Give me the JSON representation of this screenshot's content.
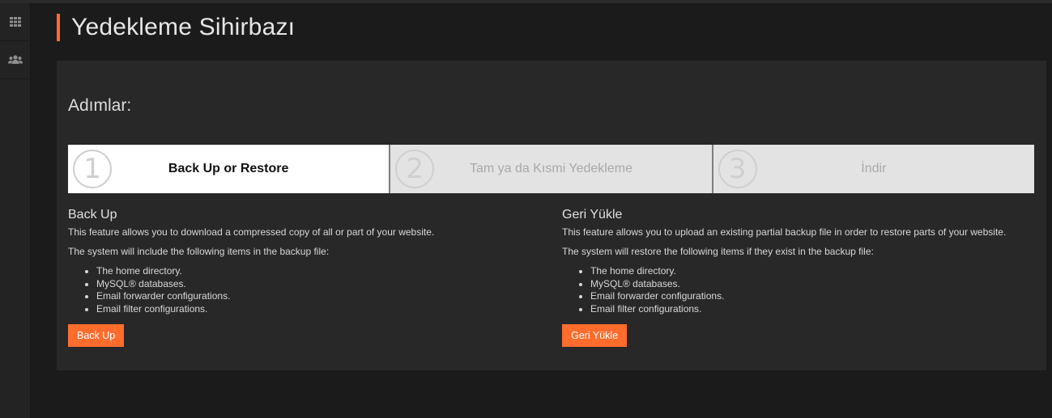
{
  "sidebar": {
    "items": [
      {
        "icon": "grid-icon"
      },
      {
        "icon": "users-icon"
      }
    ]
  },
  "page": {
    "title": "Yedekleme Sihirbazı",
    "accent_color": "#ff6c2c"
  },
  "wizard": {
    "heading": "Adımlar:",
    "steps": [
      {
        "number": "1",
        "label": "Back Up or Restore",
        "active": true
      },
      {
        "number": "2",
        "label": "Tam ya da Kısmi Yedekleme",
        "active": false
      },
      {
        "number": "3",
        "label": "İndir",
        "active": false
      }
    ]
  },
  "backup": {
    "title": "Back Up",
    "description": "This feature allows you to download a compressed copy of all or part of your website.",
    "intro": "The system will include the following items in the backup file:",
    "items": [
      "The home directory.",
      "MySQL® databases.",
      "Email forwarder configurations.",
      "Email filter configurations."
    ],
    "button_label": "Back Up"
  },
  "restore": {
    "title": "Geri Yükle",
    "description": "This feature allows you to upload an existing partial backup file in order to restore parts of your website.",
    "intro": "The system will restore the following items if they exist in the backup file:",
    "items": [
      "The home directory.",
      "MySQL® databases.",
      "Email forwarder configurations.",
      "Email filter configurations."
    ],
    "button_label": "Geri Yükle"
  }
}
